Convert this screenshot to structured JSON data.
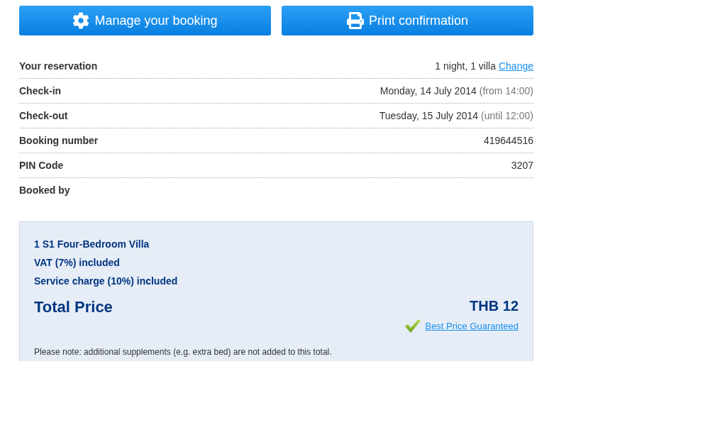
{
  "actions": [
    {
      "kind": "manage",
      "label": "Manage your booking"
    },
    {
      "kind": "print",
      "label": "Print confirmation"
    }
  ],
  "reservation": {
    "rows": [
      {
        "label": "Your reservation",
        "value": "1 night, 1 villa",
        "link": "Change"
      },
      {
        "label": "Check-in",
        "value": "Monday, 14 July 2014",
        "note": "(from 14:00)"
      },
      {
        "label": "Check-out",
        "value": "Tuesday, 15 July 2014",
        "note": "(until 12:00)"
      },
      {
        "label": "Booking number",
        "value": "419644516"
      },
      {
        "label": "PIN Code",
        "value": "3207"
      },
      {
        "label": "Booked by"
      }
    ]
  },
  "price": {
    "items": [
      "1 S1 Four-Bedroom Villa",
      "VAT (7%) included",
      "Service charge (10%) included"
    ],
    "total_label": "Total Price",
    "total": "THB 12",
    "guarantee_link": "Best Price Guaranteed",
    "note": "Please note: additional supplements (e.g. extra bed) are not added to this total."
  }
}
